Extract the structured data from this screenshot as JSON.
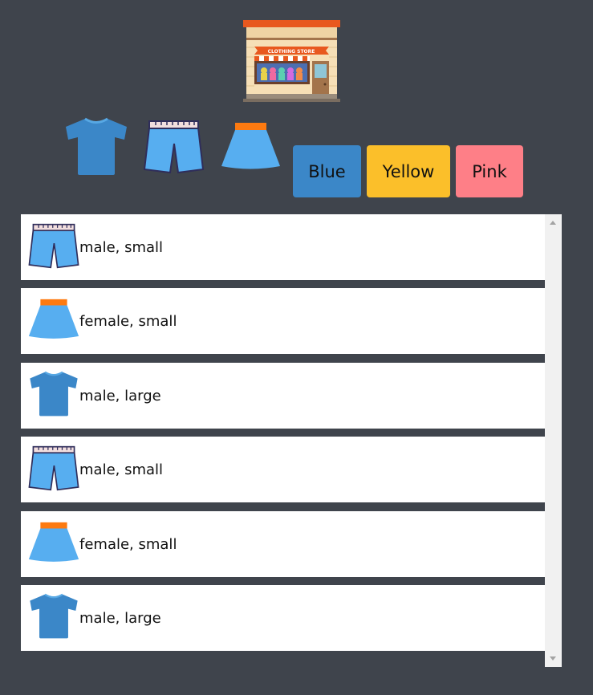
{
  "store": {
    "sign_text": "CLOTHING STORE"
  },
  "filters": {
    "types": [
      {
        "name": "tshirt",
        "icon": "tshirt-icon"
      },
      {
        "name": "shorts",
        "icon": "shorts-icon"
      },
      {
        "name": "skirt",
        "icon": "skirt-icon"
      }
    ],
    "colors": [
      {
        "label": "Blue",
        "color": "#3b87c8"
      },
      {
        "label": "Yellow",
        "color": "#fbbf2a"
      },
      {
        "label": "Pink",
        "color": "#fe7f87"
      }
    ]
  },
  "items": [
    {
      "icon": "shorts-icon",
      "label": "male, small"
    },
    {
      "icon": "skirt-icon",
      "label": "female, small"
    },
    {
      "icon": "tshirt-icon",
      "label": "male, large"
    },
    {
      "icon": "shorts-icon",
      "label": "male, small"
    },
    {
      "icon": "skirt-icon",
      "label": "female, small"
    },
    {
      "icon": "tshirt-icon",
      "label": "male, large"
    }
  ]
}
